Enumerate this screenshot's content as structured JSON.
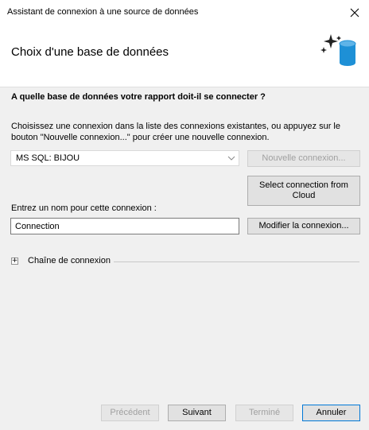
{
  "window": {
    "title": "Assistant de connexion à une source de données",
    "close_icon": "close-icon"
  },
  "header": {
    "title": "Choix d'une base de données",
    "icon": "database-sparkle-icon",
    "accent_color": "#1e90d6"
  },
  "content": {
    "question": "A quelle base de données votre rapport doit-il se connecter ?",
    "description": "Choisissez une connexion dans la liste des connexions existantes, ou appuyez sur le bouton \"Nouvelle connexion...\" pour créer une nouvelle connexion.",
    "connection_select": {
      "value": "MS SQL: BIJOU",
      "icon": "chevron-down-icon"
    },
    "new_connection_label": "Nouvelle connexion...",
    "cloud_connection_label": "Select connection from Cloud",
    "name_label": "Entrez un nom pour cette connexion :",
    "name_value": "Connection",
    "modify_label": "Modifier la connexion...",
    "expander": {
      "label": "Chaîne de connexion",
      "icon": "plus-icon",
      "expanded": false
    }
  },
  "footer": {
    "prev_label": "Précédent",
    "next_label": "Suivant",
    "finish_label": "Terminé",
    "cancel_label": "Annuler"
  }
}
